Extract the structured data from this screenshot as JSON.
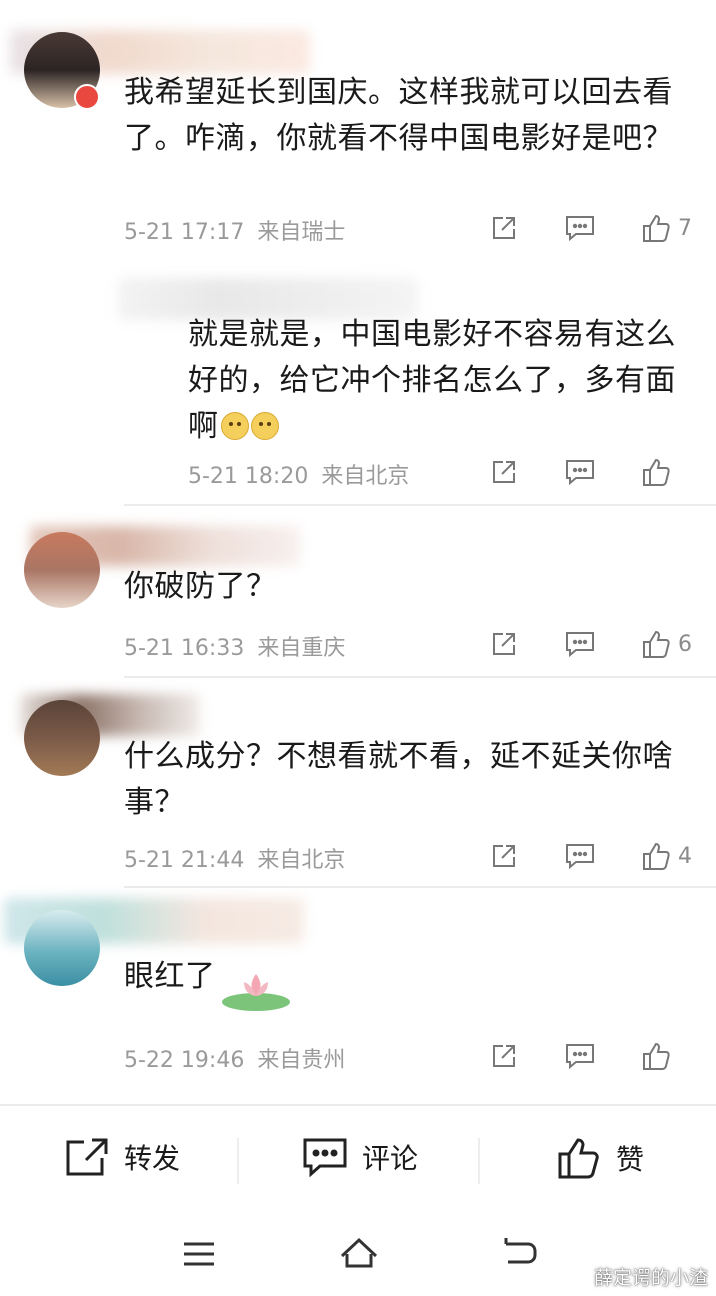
{
  "comments": [
    {
      "text": "我希望延长到国庆。这样我就可以回去看了。咋滴，你就看不得中国电影好是吧？",
      "time": "5-21 17:17",
      "location": "来自瑞士",
      "likes": "7",
      "reply": {
        "text": "就是就是，中国电影好不容易有这么好的，给它冲个排名怎么了，多有面啊",
        "time": "5-21 18:20",
        "location": "来自北京",
        "likes": ""
      }
    },
    {
      "text": "你破防了？",
      "time": "5-21 16:33",
      "location": "来自重庆",
      "likes": "6"
    },
    {
      "text": "什么成分？不想看就不看，延不延关你啥事？",
      "time": "5-21 21:44",
      "location": "来自北京",
      "likes": "4"
    },
    {
      "text": "眼红了",
      "time": "5-22 19:46",
      "location": "来自贵州",
      "likes": ""
    }
  ],
  "bottom_bar": {
    "repost": "转发",
    "comment": "评论",
    "like": "赞"
  },
  "watermark": "薛定谔的小渣",
  "icons": {
    "share": "share-icon",
    "comment": "comment-icon",
    "like": "thumbs-up-icon",
    "menu": "menu-icon",
    "home": "home-icon",
    "back": "back-icon"
  },
  "colors": {
    "meta": "#9a9a9a",
    "divider": "#ececec",
    "text": "#1a1a1a"
  }
}
